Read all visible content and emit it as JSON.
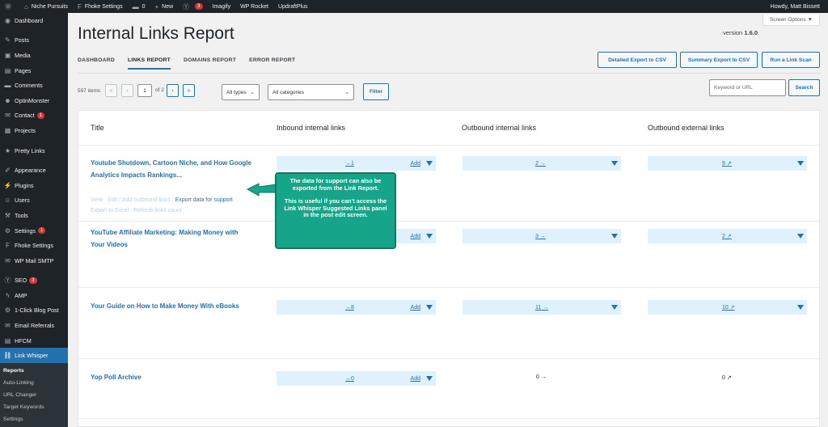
{
  "adminbar": {
    "site_name": "Niche Pursuits",
    "theme": "Fhoke Settings",
    "comments": "0",
    "new": "New",
    "badge": "3",
    "imagify": "Imagify",
    "wp_rocket": "WP Rocket",
    "updraft": "UpdraftPlus",
    "howdy": "Howdy, Matt Bissett"
  },
  "sidebar": {
    "items": [
      {
        "label": "Dashboard"
      },
      {
        "label": "Posts"
      },
      {
        "label": "Media"
      },
      {
        "label": "Pages"
      },
      {
        "label": "Comments"
      },
      {
        "label": "OptinMonster"
      },
      {
        "label": "Contact",
        "badge": "1"
      },
      {
        "label": "Projects"
      },
      {
        "label": "Pretty Links"
      },
      {
        "label": "Appearance"
      },
      {
        "label": "Plugins"
      },
      {
        "label": "Users"
      },
      {
        "label": "Tools"
      },
      {
        "label": "Settings",
        "badge": "1"
      },
      {
        "label": "Fhoke Settings"
      },
      {
        "label": "WP Mail SMTP"
      },
      {
        "label": "SEO",
        "badge": "3"
      },
      {
        "label": "AMP"
      },
      {
        "label": "1-Click Blog Post"
      },
      {
        "label": "Email Referrals"
      },
      {
        "label": "HFCM"
      },
      {
        "label": "Link Whisper"
      }
    ],
    "submenu": [
      "Reports",
      "Auto-Linking",
      "URL Changer",
      "Target Keywords",
      "Settings"
    ]
  },
  "header": {
    "screen_options": "Screen Options ▼",
    "title": "Internal Links Report",
    "version_label": "version",
    "version": "1.6.0"
  },
  "tabs": [
    "DASHBOARD",
    "LINKS REPORT",
    "DOMAINS REPORT",
    "ERROR REPORT"
  ],
  "buttons": {
    "detailed_export": "Detailed Export to CSV",
    "summary_export": "Summary Export to CSV",
    "run_scan": "Run a Link Scan",
    "filter": "Filter",
    "search": "Search"
  },
  "toolbar": {
    "items_count": "597 items",
    "first": "«",
    "prev": "‹",
    "current_page": "1",
    "of_pages": "of 2",
    "next": "›",
    "last": "»",
    "type_select": "All types",
    "category_select": "All categories",
    "search_placeholder": "Keyword or URL"
  },
  "table": {
    "headers": {
      "title": "Title",
      "inbound": "Inbound internal links",
      "outbound_internal": "Outbound internal links",
      "outbound_external": "Outbound external links"
    },
    "rows": [
      {
        "title": "Youtube Shutdown, Cartoon Niche, and How Google Analytics Impacts Rankings...",
        "inbound": "1",
        "outbound_internal": "2",
        "outbound_external": "9"
      },
      {
        "title": "YouTube Affiliate Marketing: Making Money with Your Videos",
        "inbound": "",
        "outbound_internal": "3",
        "outbound_external": "2"
      },
      {
        "title": "Your Guide on How to Make Money With eBooks",
        "inbound": "8",
        "outbound_internal": "11",
        "outbound_external": "10"
      },
      {
        "title": "Yop Poll Archive",
        "inbound": "0",
        "outbound_internal": "0",
        "outbound_external": "0"
      }
    ],
    "add_label": "Add",
    "row_actions": {
      "view_edit": "View · Edit / Add outbound links ·",
      "export_support": "Export data for support",
      "rest": "· Export to Excel · Refresh links count"
    }
  },
  "callout": {
    "line1": "The data for support can also be exported from the Link Report.",
    "line2": "This is useful if you can't access the Link Whisper Suggested Links panel in the post edit screen."
  },
  "colors": {
    "accent": "#2271b1",
    "admin_dark": "#1d2327",
    "callout": "#17a589",
    "cell_bg": "#dff1fc",
    "badge": "#d63638"
  }
}
